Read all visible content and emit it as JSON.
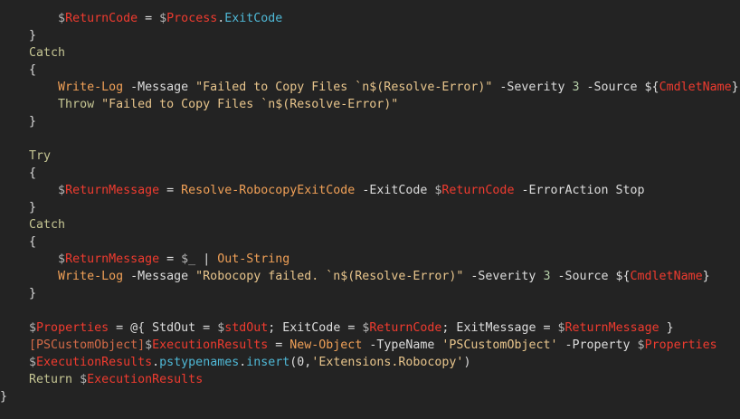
{
  "colors": {
    "background": "#232323",
    "default": "#dcdcdc",
    "variable": "#ef3b2f",
    "keyword": "#c5c593",
    "command": "#f0a057",
    "string": "#e8c58c",
    "member": "#4fb8d6"
  },
  "code": {
    "lines": [
      [
        {
          "t": "        ",
          "k": "default"
        },
        {
          "t": "$",
          "k": "sigil"
        },
        {
          "t": "ReturnCode",
          "k": "var"
        },
        {
          "t": " = ",
          "k": "op"
        },
        {
          "t": "$",
          "k": "sigil"
        },
        {
          "t": "Process",
          "k": "var"
        },
        {
          "t": ".",
          "k": "punct"
        },
        {
          "t": "ExitCode",
          "k": "member"
        }
      ],
      [
        {
          "t": "    }",
          "k": "punct"
        }
      ],
      [
        {
          "t": "    ",
          "k": "default"
        },
        {
          "t": "Catch",
          "k": "kw"
        }
      ],
      [
        {
          "t": "    {",
          "k": "punct"
        }
      ],
      [
        {
          "t": "        ",
          "k": "default"
        },
        {
          "t": "Write-Log",
          "k": "cmd"
        },
        {
          "t": " -Message ",
          "k": "param"
        },
        {
          "t": "\"Failed to Copy Files `n$(Resolve-Error)\"",
          "k": "str"
        },
        {
          "t": " -Severity ",
          "k": "param"
        },
        {
          "t": "3",
          "k": "num"
        },
        {
          "t": " -Source ",
          "k": "param"
        },
        {
          "t": "${",
          "k": "punct"
        },
        {
          "t": "CmdletName",
          "k": "var"
        },
        {
          "t": "}",
          "k": "punct"
        }
      ],
      [
        {
          "t": "        ",
          "k": "default"
        },
        {
          "t": "Throw",
          "k": "kw"
        },
        {
          "t": " ",
          "k": "default"
        },
        {
          "t": "\"Failed to Copy Files `n$(Resolve-Error)\"",
          "k": "str"
        }
      ],
      [
        {
          "t": "    }",
          "k": "punct"
        }
      ],
      [
        {
          "t": "",
          "k": "default"
        }
      ],
      [
        {
          "t": "    ",
          "k": "default"
        },
        {
          "t": "Try",
          "k": "kw"
        }
      ],
      [
        {
          "t": "    {",
          "k": "punct"
        }
      ],
      [
        {
          "t": "        ",
          "k": "default"
        },
        {
          "t": "$",
          "k": "sigil"
        },
        {
          "t": "ReturnMessage",
          "k": "var"
        },
        {
          "t": " = ",
          "k": "op"
        },
        {
          "t": "Resolve-RobocopyExitCode",
          "k": "cmd"
        },
        {
          "t": " -ExitCode ",
          "k": "param"
        },
        {
          "t": "$",
          "k": "sigil"
        },
        {
          "t": "ReturnCode",
          "k": "var"
        },
        {
          "t": " -ErrorAction Stop",
          "k": "param"
        }
      ],
      [
        {
          "t": "    }",
          "k": "punct"
        }
      ],
      [
        {
          "t": "    ",
          "k": "default"
        },
        {
          "t": "Catch",
          "k": "kw"
        }
      ],
      [
        {
          "t": "    {",
          "k": "punct"
        }
      ],
      [
        {
          "t": "        ",
          "k": "default"
        },
        {
          "t": "$",
          "k": "sigil"
        },
        {
          "t": "ReturnMessage",
          "k": "var"
        },
        {
          "t": " = ",
          "k": "op"
        },
        {
          "t": "$_",
          "k": "sigil"
        },
        {
          "t": " | ",
          "k": "op"
        },
        {
          "t": "Out-String",
          "k": "cmd"
        }
      ],
      [
        {
          "t": "        ",
          "k": "default"
        },
        {
          "t": "Write-Log",
          "k": "cmd"
        },
        {
          "t": " -Message ",
          "k": "param"
        },
        {
          "t": "\"Robocopy failed. `n$(Resolve-Error)\"",
          "k": "str"
        },
        {
          "t": " -Severity ",
          "k": "param"
        },
        {
          "t": "3",
          "k": "num"
        },
        {
          "t": " -Source ",
          "k": "param"
        },
        {
          "t": "${",
          "k": "punct"
        },
        {
          "t": "CmdletName",
          "k": "var"
        },
        {
          "t": "}",
          "k": "punct"
        }
      ],
      [
        {
          "t": "    }",
          "k": "punct"
        }
      ],
      [
        {
          "t": "",
          "k": "default"
        }
      ],
      [
        {
          "t": "    ",
          "k": "default"
        },
        {
          "t": "$",
          "k": "sigil"
        },
        {
          "t": "Properties",
          "k": "var"
        },
        {
          "t": " = @{ StdOut = ",
          "k": "op"
        },
        {
          "t": "$",
          "k": "sigil"
        },
        {
          "t": "stdOut",
          "k": "var"
        },
        {
          "t": "; ExitCode = ",
          "k": "op"
        },
        {
          "t": "$",
          "k": "sigil"
        },
        {
          "t": "ReturnCode",
          "k": "var"
        },
        {
          "t": "; ExitMessage = ",
          "k": "op"
        },
        {
          "t": "$",
          "k": "sigil"
        },
        {
          "t": "ReturnMessage",
          "k": "var"
        },
        {
          "t": " }",
          "k": "punct"
        }
      ],
      [
        {
          "t": "    ",
          "k": "default"
        },
        {
          "t": "[PSCustomObject]",
          "k": "type"
        },
        {
          "t": "$",
          "k": "sigil"
        },
        {
          "t": "ExecutionResults",
          "k": "var"
        },
        {
          "t": " = ",
          "k": "op"
        },
        {
          "t": "New-Object",
          "k": "cmd"
        },
        {
          "t": " -TypeName ",
          "k": "param"
        },
        {
          "t": "'PSCustomObject'",
          "k": "str"
        },
        {
          "t": " -Property ",
          "k": "param"
        },
        {
          "t": "$",
          "k": "sigil"
        },
        {
          "t": "Properties",
          "k": "var"
        }
      ],
      [
        {
          "t": "    ",
          "k": "default"
        },
        {
          "t": "$",
          "k": "sigil"
        },
        {
          "t": "ExecutionResults",
          "k": "var"
        },
        {
          "t": ".",
          "k": "punct"
        },
        {
          "t": "pstypenames",
          "k": "member"
        },
        {
          "t": ".",
          "k": "punct"
        },
        {
          "t": "insert",
          "k": "member"
        },
        {
          "t": "(0,",
          "k": "punct"
        },
        {
          "t": "'Extensions.Robocopy'",
          "k": "str"
        },
        {
          "t": ")",
          "k": "punct"
        }
      ],
      [
        {
          "t": "    ",
          "k": "default"
        },
        {
          "t": "Return",
          "k": "kw"
        },
        {
          "t": " ",
          "k": "default"
        },
        {
          "t": "$",
          "k": "sigil"
        },
        {
          "t": "ExecutionResults",
          "k": "var"
        }
      ],
      [
        {
          "t": "}",
          "k": "punct"
        }
      ]
    ]
  }
}
